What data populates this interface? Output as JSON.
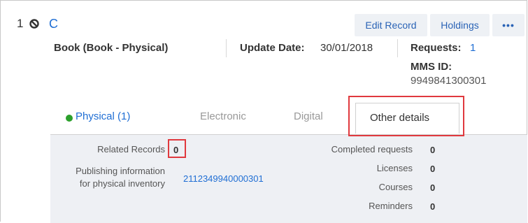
{
  "record": {
    "row_number": "1",
    "title": "C",
    "material_type": "Book (Book - Physical)",
    "update_date_label": "Update Date:",
    "update_date_value": "30/01/2018",
    "requests_label": "Requests:",
    "requests_value": "1",
    "mms_id_label": "MMS ID:",
    "mms_id_value": "9949841300301"
  },
  "actions": {
    "edit_record": "Edit Record",
    "holdings": "Holdings",
    "more": "•••"
  },
  "tabs": [
    {
      "label": "Physical (1)",
      "status_color": "#2ca02c"
    },
    {
      "label": "Electronic"
    },
    {
      "label": "Digital"
    },
    {
      "label": "Other details",
      "active": true
    }
  ],
  "details": {
    "left": [
      {
        "label": "Related Records",
        "value": "0"
      },
      {
        "label": "Publishing information for physical inventory",
        "value": "2112349940000301"
      }
    ],
    "right": [
      {
        "label": "Completed requests",
        "value": "0"
      },
      {
        "label": "Licenses",
        "value": "0"
      },
      {
        "label": "Courses",
        "value": "0"
      },
      {
        "label": "Reminders",
        "value": "0"
      }
    ]
  },
  "colors": {
    "link": "#1f6ed4",
    "highlight": "#e0393e",
    "panel_bg": "#eef0f4"
  }
}
